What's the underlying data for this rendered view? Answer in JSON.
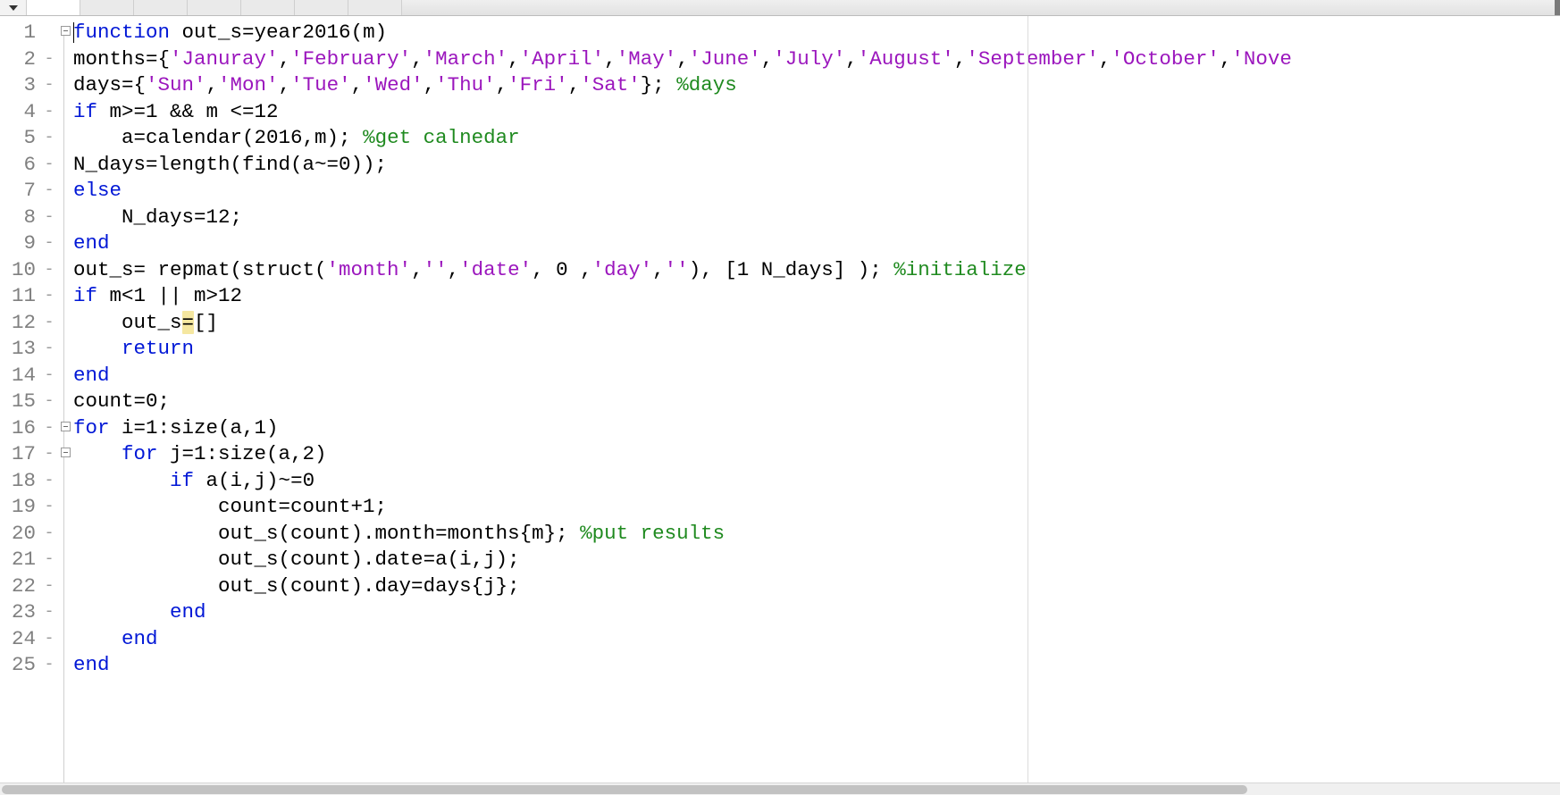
{
  "tabs": {
    "t0_label": "",
    "t1_label": "",
    "t2_label": "",
    "t3_label": "",
    "t4_label": "",
    "t5_label": "",
    "t6_label": ""
  },
  "lines": {
    "l1": {
      "num": "1",
      "bp": "",
      "fold": "minus",
      "seg": {
        "a": "function",
        "b": " out_s=year2016(m)"
      }
    },
    "l2": {
      "num": "2",
      "bp": "-",
      "fold": "",
      "seg": {
        "a": "months={",
        "b": "'Januray'",
        "c": ",",
        "d": "'February'",
        "e": ",",
        "f": "'March'",
        "g": ",",
        "h": "'April'",
        "i": ",",
        "j": "'May'",
        "k": ",",
        "l": "'June'",
        "m": ",",
        "n": "'July'",
        "o": ",",
        "p": "'August'",
        "q": ",",
        "r": "'September'",
        "s": ",",
        "t": "'October'",
        "u": ",",
        "v": "'Nove"
      }
    },
    "l3": {
      "num": "3",
      "bp": "-",
      "fold": "",
      "seg": {
        "a": "days={",
        "b": "'Sun'",
        "c": ",",
        "d": "'Mon'",
        "e": ",",
        "f": "'Tue'",
        "g": ",",
        "h": "'Wed'",
        "i": ",",
        "j": "'Thu'",
        "k": ",",
        "l": "'Fri'",
        "m": ",",
        "n": "'Sat'",
        "o": "}; ",
        "p": "%days"
      }
    },
    "l4": {
      "num": "4",
      "bp": "-",
      "fold": "",
      "seg": {
        "a": "if",
        "b": " m>=1 && m <=12"
      }
    },
    "l5": {
      "num": "5",
      "bp": "-",
      "fold": "",
      "seg": {
        "a": "    a=calendar(2016,m); ",
        "b": "%get calnedar"
      }
    },
    "l6": {
      "num": "6",
      "bp": "-",
      "fold": "",
      "seg": {
        "a": "N_days=length(find(a~=0));"
      }
    },
    "l7": {
      "num": "7",
      "bp": "-",
      "fold": "",
      "seg": {
        "a": "else"
      }
    },
    "l8": {
      "num": "8",
      "bp": "-",
      "fold": "",
      "seg": {
        "a": "    N_days=12;"
      }
    },
    "l9": {
      "num": "9",
      "bp": "-",
      "fold": "",
      "seg": {
        "a": "end"
      }
    },
    "l10": {
      "num": "10",
      "bp": "-",
      "fold": "",
      "seg": {
        "a": "out_s= repmat(struct(",
        "b": "'month'",
        "c": ",",
        "d": "''",
        "e": ",",
        "f": "'date'",
        "g": ", 0 ,",
        "h": "'day'",
        "i": ",",
        "j": "''",
        "k": "), [1 N_days] ); ",
        "l": "%initialize"
      }
    },
    "l11": {
      "num": "11",
      "bp": "-",
      "fold": "",
      "seg": {
        "a": "if",
        "b": " m<1 || m>12"
      }
    },
    "l12": {
      "num": "12",
      "bp": "-",
      "fold": "",
      "seg": {
        "a": "    out_s",
        "b": "=",
        "c": "[]"
      }
    },
    "l13": {
      "num": "13",
      "bp": "-",
      "fold": "",
      "seg": {
        "a": "    ",
        "b": "return"
      }
    },
    "l14": {
      "num": "14",
      "bp": "-",
      "fold": "",
      "seg": {
        "a": "end"
      }
    },
    "l15": {
      "num": "15",
      "bp": "-",
      "fold": "",
      "seg": {
        "a": "count=0;"
      }
    },
    "l16": {
      "num": "16",
      "bp": "-",
      "fold": "minus",
      "seg": {
        "a": "for",
        "b": " i=1:size(a,1)"
      }
    },
    "l17": {
      "num": "17",
      "bp": "-",
      "fold": "minus",
      "seg": {
        "a": "    ",
        "b": "for",
        "c": " j=1:size(a,2)"
      }
    },
    "l18": {
      "num": "18",
      "bp": "-",
      "fold": "",
      "seg": {
        "a": "        ",
        "b": "if",
        "c": " a(i,j)~=0"
      }
    },
    "l19": {
      "num": "19",
      "bp": "-",
      "fold": "",
      "seg": {
        "a": "            count=count+1;"
      }
    },
    "l20": {
      "num": "20",
      "bp": "-",
      "fold": "",
      "seg": {
        "a": "            out_s(count).month=months{m}; ",
        "b": "%put results"
      }
    },
    "l21": {
      "num": "21",
      "bp": "-",
      "fold": "",
      "seg": {
        "a": "            out_s(count).date=a(i,j);"
      }
    },
    "l22": {
      "num": "22",
      "bp": "-",
      "fold": "",
      "seg": {
        "a": "            out_s(count).day=days{j};"
      }
    },
    "l23": {
      "num": "23",
      "bp": "-",
      "fold": "",
      "seg": {
        "a": "        ",
        "b": "end"
      }
    },
    "l24": {
      "num": "24",
      "bp": "-",
      "fold": "",
      "seg": {
        "a": "    ",
        "b": "end"
      }
    },
    "l25": {
      "num": "25",
      "bp": "-",
      "fold": "",
      "seg": {
        "a": "end"
      }
    }
  }
}
